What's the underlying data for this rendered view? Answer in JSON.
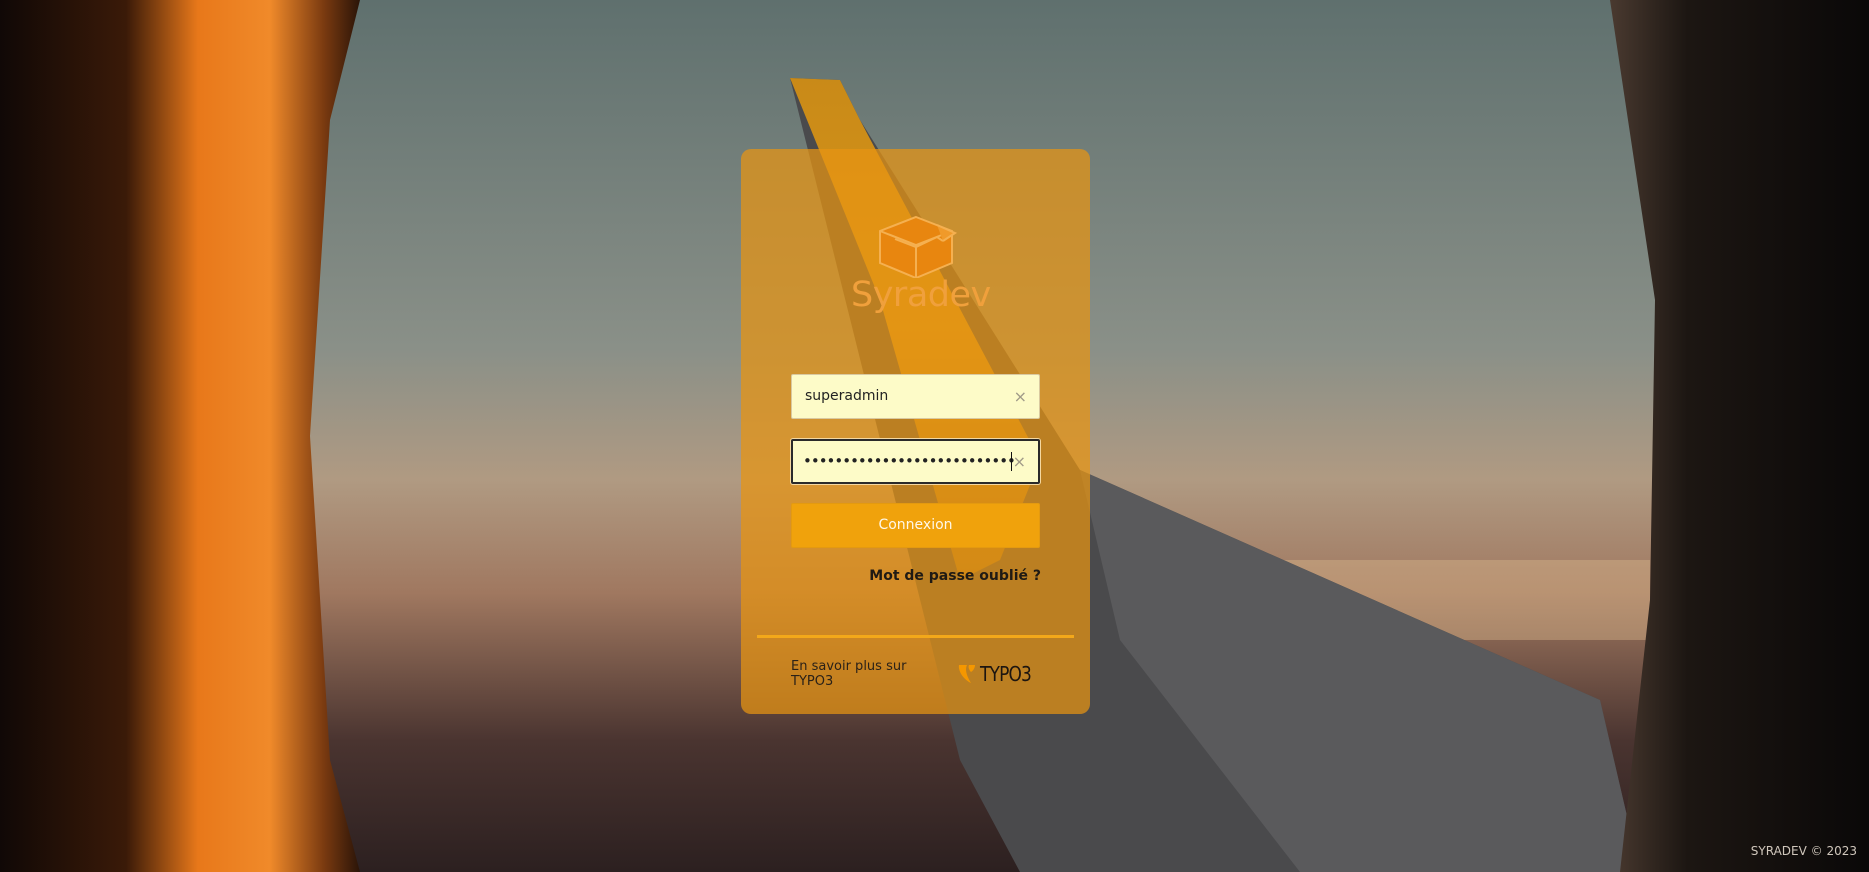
{
  "brand": {
    "logo_text": "Syradev",
    "logo_icon": "box-icon"
  },
  "login": {
    "username_value": "superadmin",
    "password_mask": "•••••••••••••••••••••••••••",
    "clear_symbol": "×",
    "submit_label": "Connexion",
    "forgot_label": "Mot de passe oublié ?"
  },
  "footer": {
    "learn_more": "En savoir plus sur TYPO3",
    "typo3_wordmark": "TYPO3"
  },
  "copyright": "SYRADEV © 2023",
  "colors": {
    "card": "#e89412",
    "button": "#f0a20c",
    "field_bg": "#fdfbc8",
    "accent": "#f3a81a"
  }
}
